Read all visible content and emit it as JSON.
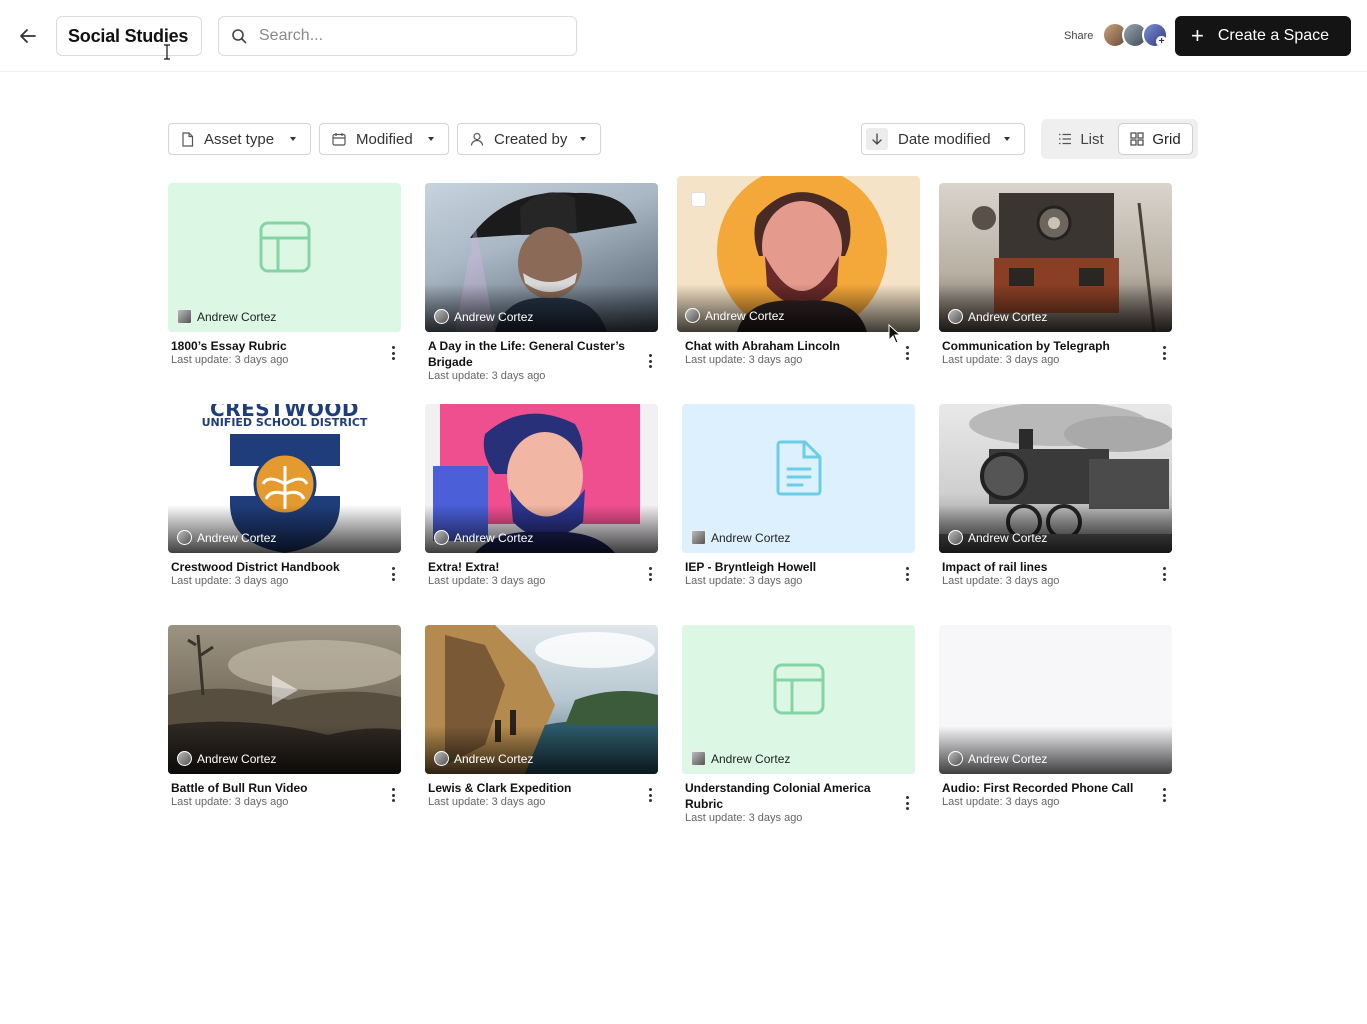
{
  "header": {
    "title": "Social Studies",
    "search_placeholder": "Search...",
    "share_label": "Share",
    "create_label": "Create a Space"
  },
  "filters": {
    "asset_type": "Asset type",
    "modified": "Modified",
    "created_by": "Created by",
    "sort": "Date modified"
  },
  "view_toggle": {
    "list": "List",
    "grid": "Grid",
    "selected": "Grid"
  },
  "cards": [
    {
      "title": "1800’s Essay Rubric",
      "owner": "Andrew Cortez",
      "updated": "Last update: 3 days ago",
      "thumb": "table-icon",
      "bg": "#dcf8e4"
    },
    {
      "title": "A Day in the Life: General Custer’s Brigade",
      "owner": "Andrew Cortez",
      "updated": "Last update: 3 days ago",
      "thumb": "image"
    },
    {
      "title": "Chat with Abraham Lincoln",
      "owner": "Andrew Cortez",
      "updated": "Last update: 3 days ago",
      "thumb": "image"
    },
    {
      "title": "Communication by Telegraph",
      "owner": "Andrew Cortez",
      "updated": "Last update: 3 days ago",
      "thumb": "image"
    },
    {
      "title": "Crestwood District Handbook",
      "owner": "Andrew Cortez",
      "updated": "Last update: 3 days ago",
      "thumb": "image",
      "logo_top": "CRESTWOOD",
      "logo_sub": "UNIFIED SCHOOL DISTRICT"
    },
    {
      "title": "Extra! Extra!",
      "owner": "Andrew Cortez",
      "updated": "Last update: 3 days ago",
      "thumb": "image"
    },
    {
      "title": "IEP - Bryntleigh Howell",
      "owner": "Andrew Cortez",
      "updated": "Last update: 3 days ago",
      "thumb": "document-icon",
      "bg": "#ddf0fd"
    },
    {
      "title": "Impact of rail lines",
      "owner": "Andrew Cortez",
      "updated": "Last update: 3 days ago",
      "thumb": "image"
    },
    {
      "title": "Battle of Bull Run Video",
      "owner": "Andrew Cortez",
      "updated": "Last update: 3 days ago",
      "thumb": "video"
    },
    {
      "title": "Lewis & Clark Expedition",
      "owner": "Andrew Cortez",
      "updated": "Last update: 3 days ago",
      "thumb": "image"
    },
    {
      "title": "Understanding Colonial America Rubric",
      "owner": "Andrew Cortez",
      "updated": "Last update: 3 days ago",
      "thumb": "table-icon",
      "bg": "#dcf8e4"
    },
    {
      "title": "Audio: First Recorded Phone Call",
      "owner": "Andrew Cortez",
      "updated": "Last update: 3 days ago",
      "thumb": "audio-waveform"
    }
  ],
  "colors": {
    "primary_button": "#141414",
    "rubric_bg": "#dcf8e4",
    "rubric_icon": "#7fcfa0",
    "doc_bg": "#ddf0fd",
    "doc_icon": "#6ccde8"
  }
}
